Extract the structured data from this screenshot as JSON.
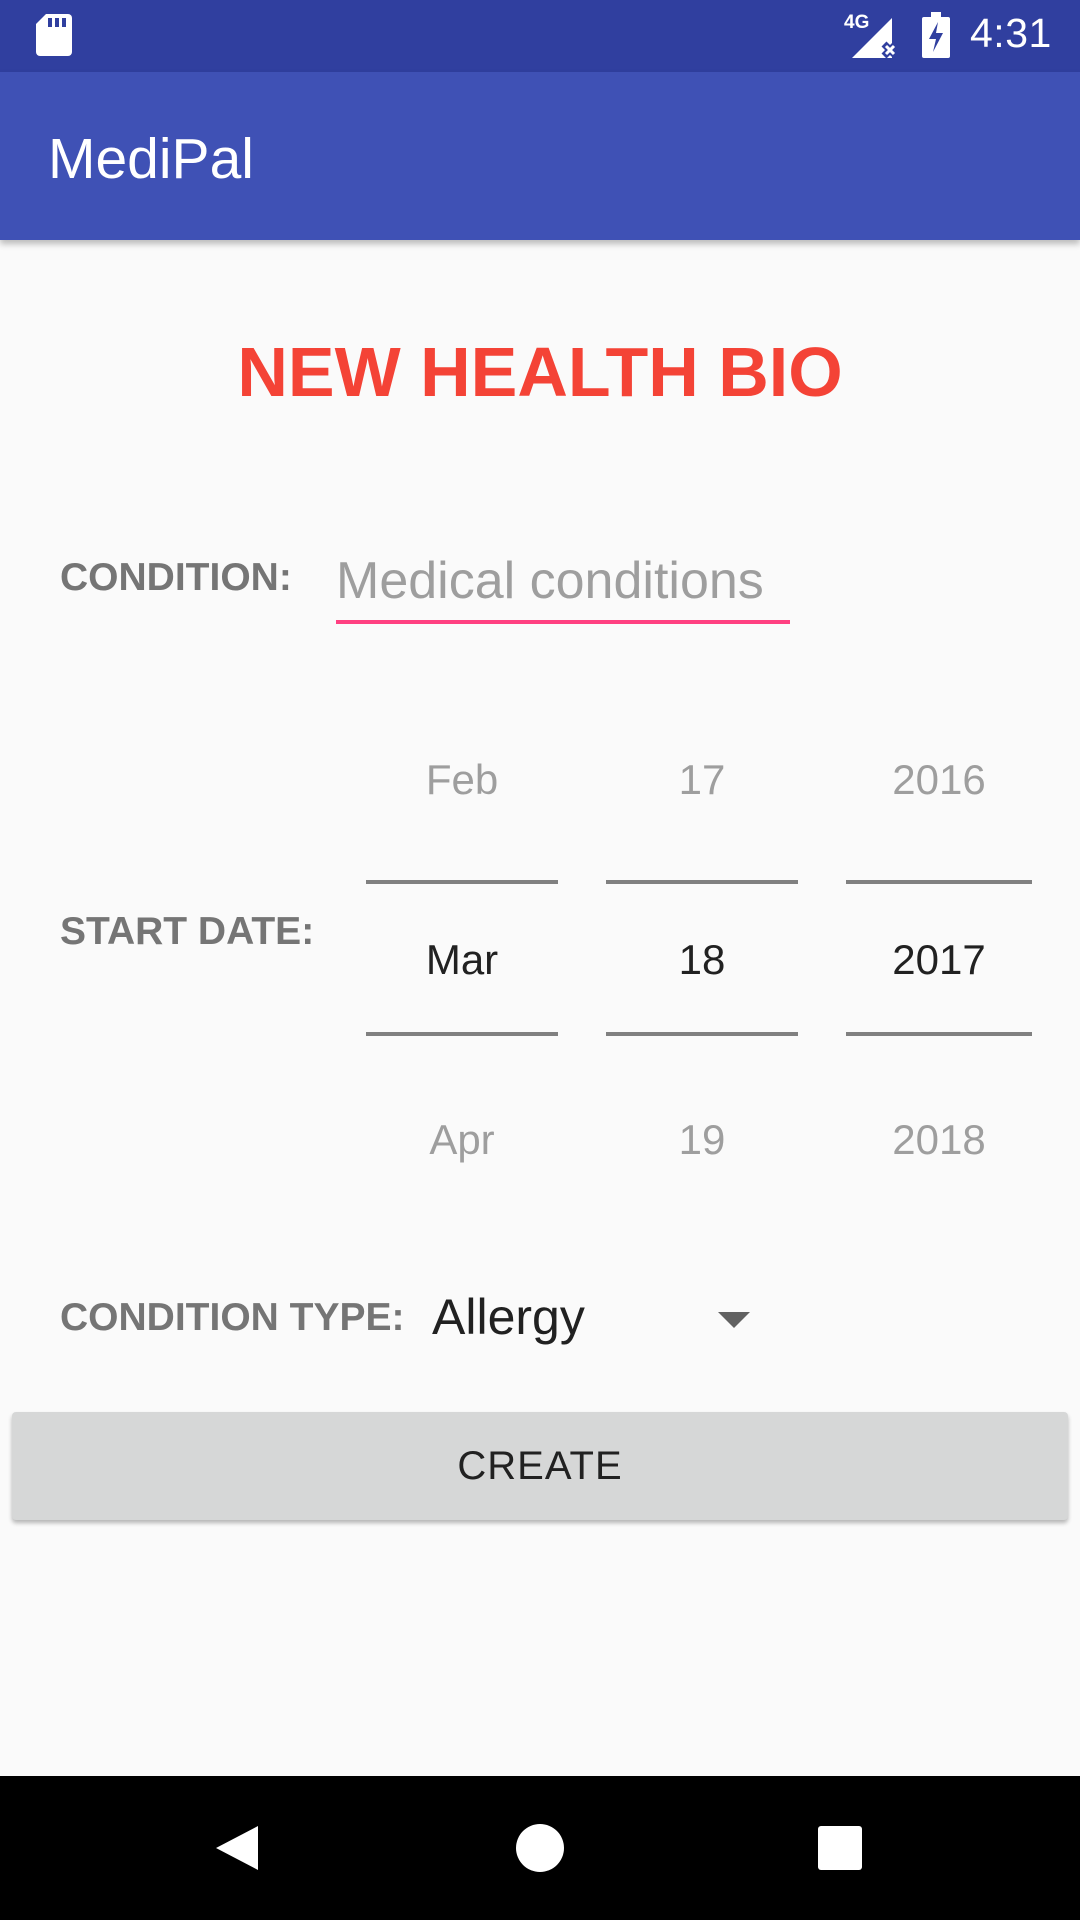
{
  "status_bar": {
    "time": "4:31",
    "network_label": "4G",
    "icons": [
      "sd-card-icon",
      "signal-no-connection-icon",
      "battery-charging-icon"
    ]
  },
  "app_bar": {
    "title": "MediPal"
  },
  "form": {
    "heading": "NEW HEALTH BIO",
    "condition_label": "CONDITION:",
    "condition_placeholder": "Medical conditions",
    "condition_value": "",
    "start_date_label": "START DATE:",
    "date_picker": {
      "month": {
        "prev": "Feb",
        "current": "Mar",
        "next": "Apr"
      },
      "day": {
        "prev": "17",
        "current": "18",
        "next": "19"
      },
      "year": {
        "prev": "2016",
        "current": "2017",
        "next": "2018"
      }
    },
    "condition_type_label": "CONDITION TYPE:",
    "condition_type_value": "Allergy",
    "create_label": "CREATE"
  },
  "nav_bar": {
    "icons": [
      "back-icon",
      "home-icon",
      "recents-icon"
    ]
  },
  "colors": {
    "status_bar": "#303f9f",
    "app_bar": "#3f51b5",
    "heading": "#f44336",
    "input_underline": "#ff4081"
  }
}
